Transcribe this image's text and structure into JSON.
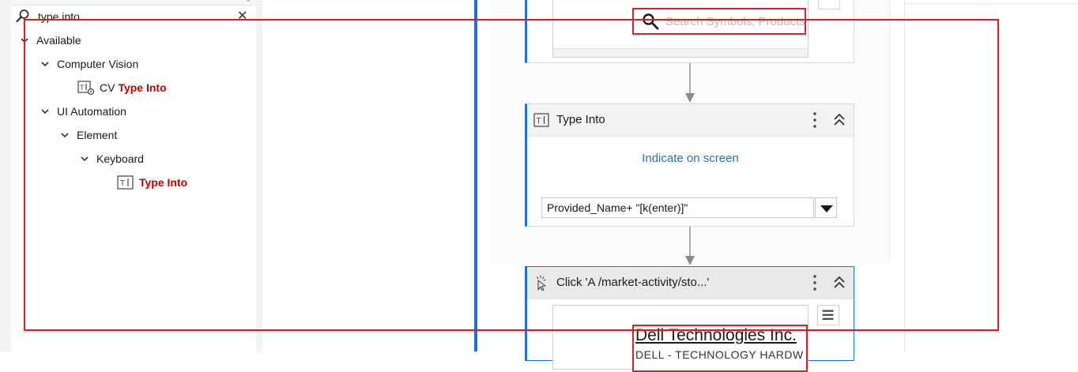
{
  "activities_panel": {
    "search": {
      "value": "type into",
      "placeholder": ""
    },
    "tree": [
      {
        "label": "Available",
        "level": 0,
        "expanded": true
      },
      {
        "label": "Computer Vision",
        "level": 1,
        "expanded": true
      },
      {
        "prefix": "CV",
        "label": "Type Into",
        "level": 2,
        "highlight": true
      },
      {
        "label": "UI Automation",
        "level": 1,
        "expanded": true
      },
      {
        "label": "Element",
        "level": 2,
        "expanded": true
      },
      {
        "label": "Keyboard",
        "level": 3,
        "expanded": true
      },
      {
        "label": "Type Into",
        "level": 4,
        "highlight": true
      }
    ]
  },
  "designer": {
    "top_card": {
      "search_placeholder": "Search Symbols, Products"
    },
    "type_into_card": {
      "title": "Type Into",
      "indicate_label": "Indicate on screen",
      "text_expression": "Provided_Name+ \"[k(enter)]\""
    },
    "click_card": {
      "title": "Click 'A  /market-activity/sto...'",
      "screenshot_title": "Dell Technologies Inc.",
      "screenshot_subtitle": "DELL - TECHNOLOGY HARDW"
    }
  },
  "colors": {
    "accent_blue": "#1f72d1",
    "highlight_red": "#c00000",
    "selection_red": "#e3191f",
    "link_blue": "#2e6fba"
  },
  "icons": {
    "search": "magnifier-icon",
    "clear": "close-icon",
    "type_into": "type-into-icon",
    "cv_type_into": "cv-type-into-icon",
    "click": "click-icon",
    "kebab": "more-vertical-icon",
    "collapse": "collapse-up-icon",
    "dropdown": "caret-down-icon",
    "menu": "hamburger-icon"
  }
}
